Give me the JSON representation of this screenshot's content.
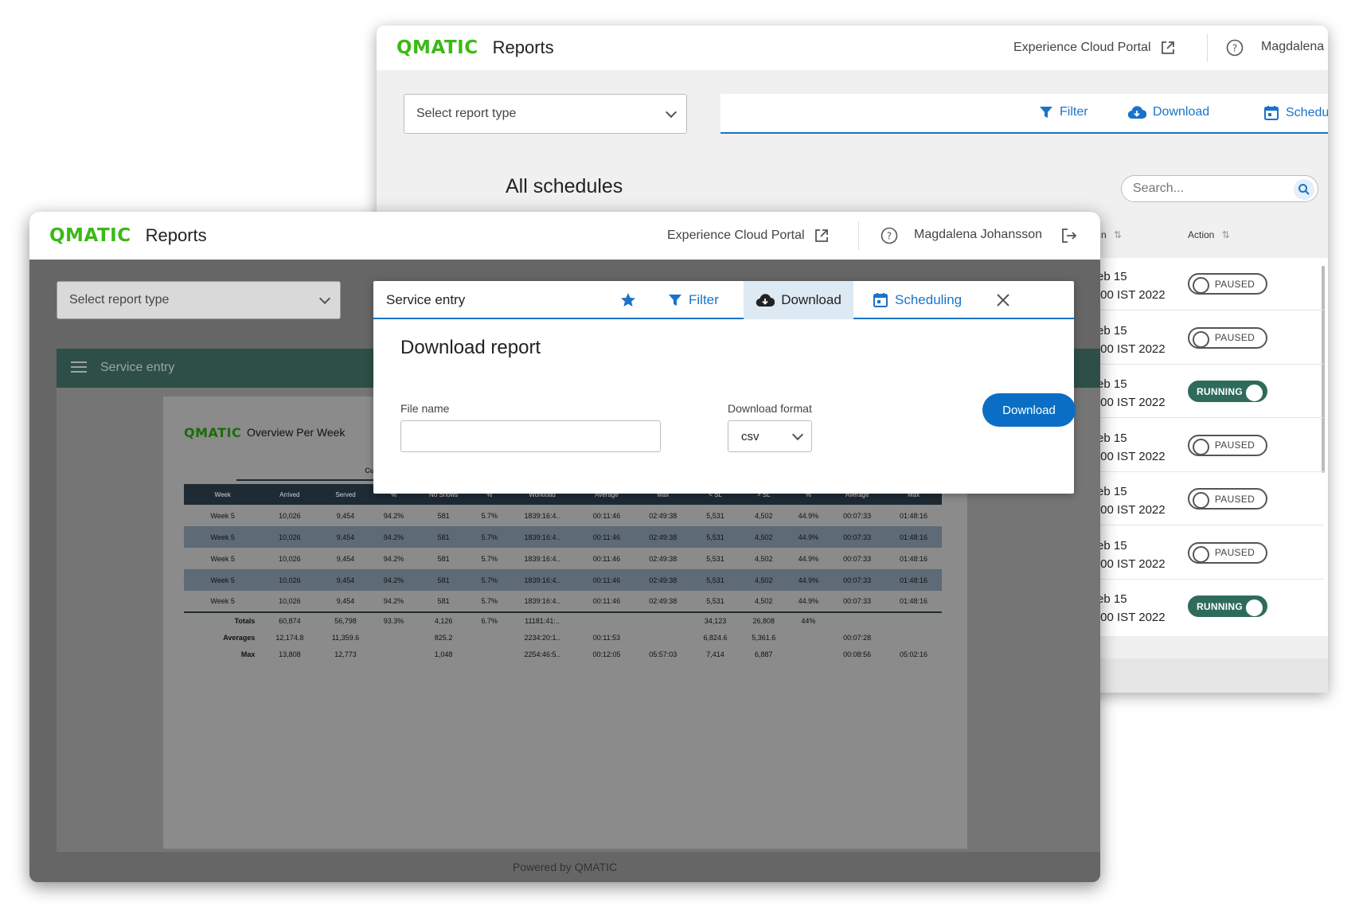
{
  "back_window": {
    "logo": "QMATIC",
    "title": "Reports",
    "portal_link": "Experience Cloud Portal",
    "user": "Magdalena",
    "select_report": "Select report type",
    "toolbar": {
      "filter": "Filter",
      "download": "Download",
      "scheduling": "Schedu"
    },
    "heading": "All schedules",
    "search_placeholder": "Search...",
    "columns": {
      "partial": "n",
      "action": "Action"
    },
    "rows": [
      {
        "date1": "eb 15",
        "date2": ":00 IST 2022",
        "status": "PAUSED",
        "on": false
      },
      {
        "date1": "eb 15",
        "date2": ":00 IST 2022",
        "status": "PAUSED",
        "on": false
      },
      {
        "date1": "eb 15",
        "date2": ":00 IST 2022",
        "status": "RUNNING",
        "on": true
      },
      {
        "date1": "eb 15",
        "date2": ":00 IST 2022",
        "status": "PAUSED",
        "on": false
      },
      {
        "date1": "eb 15",
        "date2": ":00 IST 2022",
        "status": "PAUSED",
        "on": false
      },
      {
        "date1": "eb 15",
        "date2": ":00 IST 2022",
        "status": "PAUSED",
        "on": false
      },
      {
        "date1": "eb 15",
        "date2": ":00 IST 2022",
        "status": "RUNNING",
        "on": true
      }
    ]
  },
  "front_window": {
    "logo": "QMATIC",
    "title": "Reports",
    "portal_link": "Experience Cloud Portal",
    "user": "Magdalena Johansson",
    "select_report": "Select report type",
    "report_bar_title": "Service entry",
    "report": {
      "logo": "QMATIC",
      "title": "Overview Per Week",
      "group_label": "Customer t",
      "headers": [
        "Week",
        "Arrived",
        "Served",
        "%",
        "No Shows",
        "%",
        "Workload",
        "Average",
        "Max",
        "< SL",
        "> SL",
        "%",
        "Average",
        "Max"
      ],
      "rows": [
        [
          "Week 5",
          "10,026",
          "9,454",
          "94.2%",
          "581",
          "5.7%",
          "1839:16:4..",
          "00:11:46",
          "02:49:38",
          "5,531",
          "4,502",
          "44.9%",
          "00:07:33",
          "01:48:16"
        ],
        [
          "Week 5",
          "10,026",
          "9,454",
          "94.2%",
          "581",
          "5.7%",
          "1839:16:4..",
          "00:11:46",
          "02:49:38",
          "5,531",
          "4,502",
          "44.9%",
          "00:07:33",
          "01:48:16"
        ],
        [
          "Week 5",
          "10,026",
          "9,454",
          "94.2%",
          "581",
          "5.7%",
          "1839:16:4..",
          "00:11:46",
          "02:49:38",
          "5,531",
          "4,502",
          "44.9%",
          "00:07:33",
          "01:48:16"
        ],
        [
          "Week 5",
          "10,026",
          "9,454",
          "94.2%",
          "581",
          "5.7%",
          "1839:16:4..",
          "00:11:46",
          "02:49:38",
          "5,531",
          "4,502",
          "44.9%",
          "00:07:33",
          "01:48:16"
        ],
        [
          "Week 5",
          "10,026",
          "9,454",
          "94.2%",
          "581",
          "5.7%",
          "1839:16:4..",
          "00:11:46",
          "02:49:38",
          "5,531",
          "4,502",
          "44.9%",
          "00:07:33",
          "01:48:16"
        ]
      ],
      "totals": [
        [
          "Totals",
          "60,874",
          "56,798",
          "93.3%",
          "4,126",
          "6.7%",
          "11181:41:..",
          "",
          "",
          "34,123",
          "26,808",
          "44%",
          "",
          ""
        ],
        [
          "Averages",
          "12,174.8",
          "11,359.6",
          "",
          "825.2",
          "",
          "2234:20:1..",
          "00:11:53",
          "",
          "6,824.6",
          "5,361.6",
          "",
          "00:07:28",
          ""
        ],
        [
          "Max",
          "13,808",
          "12,773",
          "",
          "1,048",
          "",
          "2254:46:5..",
          "00:12:05",
          "05:57:03",
          "7,414",
          "6,887",
          "",
          "00:08:56",
          "05:02:16"
        ]
      ]
    },
    "footer": "Powered by QMATIC",
    "modal": {
      "tab_title": "Service entry",
      "filter": "Filter",
      "download": "Download",
      "scheduling": "Scheduling",
      "heading": "Download report",
      "file_name_label": "File name",
      "file_name_value": "",
      "format_label": "Download format",
      "format_value": "csv",
      "download_button": "Download"
    }
  },
  "colors": {
    "brand_green": "#3cb916",
    "accent_blue": "#1a73c8",
    "toggle_on": "#2f6b5b",
    "report_bar": "#2d4f47"
  }
}
